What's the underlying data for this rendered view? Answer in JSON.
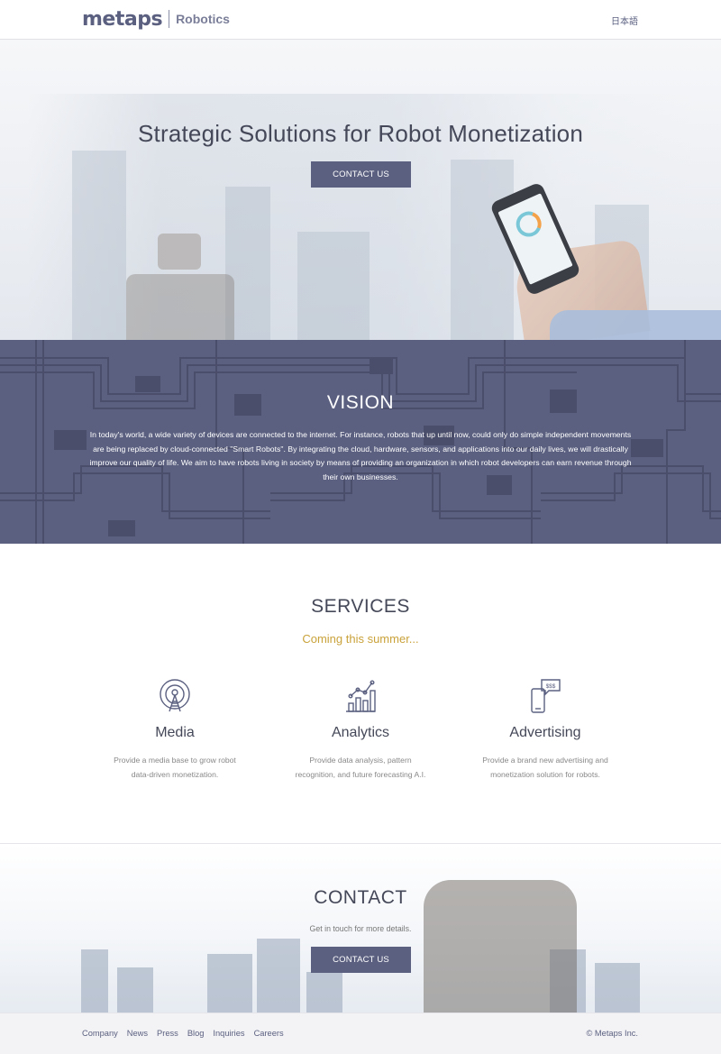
{
  "header": {
    "logo_brand": "metaps",
    "logo_sub": "Robotics",
    "language_link": "日本語"
  },
  "hero": {
    "title": "Strategic Solutions for Robot Monetization",
    "button_label": "CONTACT US"
  },
  "vision": {
    "title": "VISION",
    "text": "In today's world, a wide variety of devices are connected to the internet. For instance, robots that up until now, could only do simple independent movements are being replaced by cloud-connected \"Smart Robots\". By integrating the cloud, hardware, sensors, and applications into our daily lives, we will drastically improve our quality of life. We aim to have robots living in society by means of providing an organization in which robot developers can earn revenue through their own businesses."
  },
  "services": {
    "title": "SERVICES",
    "subtitle": "Coming this summer...",
    "items": [
      {
        "icon": "broadcast-tower-icon",
        "name": "Media",
        "description": "Provide a media base to grow robot data-driven monetization."
      },
      {
        "icon": "bar-chart-icon",
        "name": "Analytics",
        "description": "Provide data analysis, pattern recognition, and future forecasting A.I."
      },
      {
        "icon": "phone-ad-icon",
        "name": "Advertising",
        "description": "Provide a brand new advertising and monetization solution for robots."
      }
    ]
  },
  "contact": {
    "title": "CONTACT",
    "subtitle": "Get in touch for more details.",
    "button_label": "CONTACT US"
  },
  "footer": {
    "links": [
      "Company",
      "News",
      "Press",
      "Blog",
      "Inquiries",
      "Careers"
    ],
    "copyright": "© Metaps Inc."
  },
  "colors": {
    "brand": "#5b6080",
    "accent_gold": "#c9a23a",
    "heading": "#454858"
  },
  "icon_badge_text": "$$$"
}
